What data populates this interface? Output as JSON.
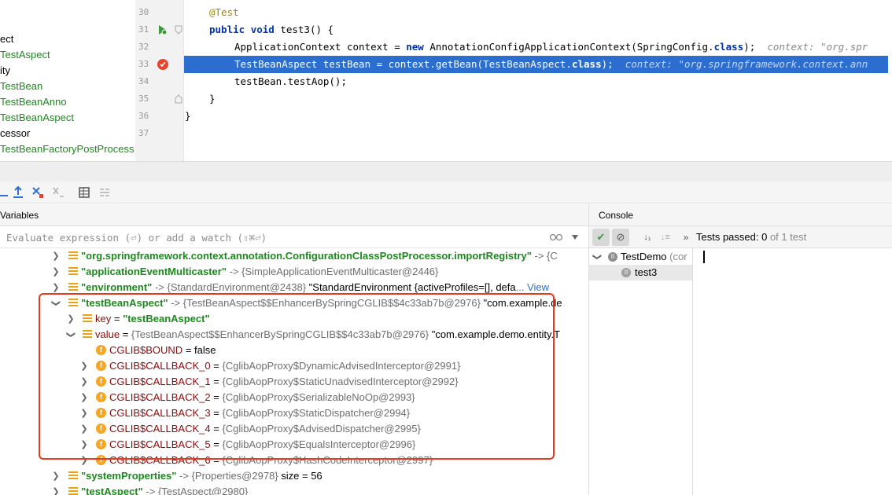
{
  "project_tree": [
    {
      "label": "ect",
      "color": "plain"
    },
    {
      "label": "TestAspect",
      "color": "green"
    },
    {
      "label": "ity",
      "color": "plain"
    },
    {
      "label": "TestBean",
      "color": "green"
    },
    {
      "label": "TestBeanAnno",
      "color": "green"
    },
    {
      "label": "TestBeanAspect",
      "color": "green"
    },
    {
      "label": "cessor",
      "color": "plain"
    },
    {
      "label": "TestBeanFactoryPostProcess",
      "color": "green"
    }
  ],
  "editor": {
    "line_numbers": [
      "30",
      "31",
      "32",
      "33",
      "34",
      "35",
      "36",
      "37"
    ],
    "lines": {
      "l30": {
        "annotation": "@Test"
      },
      "l31": {
        "kw1": "public",
        "kw2": "void",
        "rest": " test3() {"
      },
      "l32": {
        "pre": "ApplicationContext context = ",
        "kw": "new",
        "mid": " AnnotationConfigApplicationContext(SpringConfig.",
        "kw2": "class",
        "post": ");",
        "inlay": "context: \"org.spr"
      },
      "l33": {
        "pre": "TestBeanAspect testBean = context.getBean(TestBeanAspect.",
        "kw": "class",
        "post": ");",
        "inlay": "context: \"org.springframework.context.ann"
      },
      "l34": {
        "text": "testBean.testAop();"
      },
      "l35": {
        "text": "}"
      },
      "l36": {
        "text": "}"
      }
    }
  },
  "variables": {
    "title": "Variables",
    "eval_placeholder": "Evaluate expression (⏎) or add a watch (⇧⌘⏎)",
    "rows": {
      "r0": {
        "name": "\"org.springframework.context.annotation.ConfigurationClassPostProcessor.importRegistry\"",
        "arrow": " -> ",
        "value": "{C"
      },
      "r1": {
        "name": "\"applicationEventMulticaster\"",
        "arrow": " -> ",
        "value": "{SimpleApplicationEventMulticaster@2446}"
      },
      "r2": {
        "name": "\"environment\"",
        "arrow": " -> ",
        "value": "{StandardEnvironment@2438}",
        "extra": " \"StandardEnvironment {activeProfiles=[], defa",
        "link": "... View"
      },
      "r3": {
        "name": "\"testBeanAspect\"",
        "arrow": " -> ",
        "value": "{TestBeanAspect$$EnhancerBySpringCGLIB$$4c33ab7b@2976}",
        "extra": " \"com.example.de"
      },
      "r4": {
        "name": "key",
        "eq": " = ",
        "value": "\"testBeanAspect\""
      },
      "r5": {
        "name": "value",
        "eq": " = ",
        "value": "{TestBeanAspect$$EnhancerBySpringCGLIB$$4c33ab7b@2976}",
        "extra": " \"com.example.demo.entity.T"
      },
      "r6": {
        "name": "CGLIB$BOUND",
        "eq": " = ",
        "value": "false"
      },
      "r7": {
        "name": "CGLIB$CALLBACK_0",
        "eq": " = ",
        "value": "{CglibAopProxy$DynamicAdvisedInterceptor@2991}"
      },
      "r8": {
        "name": "CGLIB$CALLBACK_1",
        "eq": " = ",
        "value": "{CglibAopProxy$StaticUnadvisedInterceptor@2992}"
      },
      "r9": {
        "name": "CGLIB$CALLBACK_2",
        "eq": " = ",
        "value": "{CglibAopProxy$SerializableNoOp@2993}"
      },
      "r10": {
        "name": "CGLIB$CALLBACK_3",
        "eq": " = ",
        "value": "{CglibAopProxy$StaticDispatcher@2994}"
      },
      "r11": {
        "name": "CGLIB$CALLBACK_4",
        "eq": " = ",
        "value": "{CglibAopProxy$AdvisedDispatcher@2995}"
      },
      "r12": {
        "name": "CGLIB$CALLBACK_5",
        "eq": " = ",
        "value": "{CglibAopProxy$EqualsInterceptor@2996}"
      },
      "r13": {
        "name": "CGLIB$CALLBACK_6",
        "eq": " = ",
        "value": "{CglibAopProxy$HashCodeInterceptor@2997}"
      },
      "r14": {
        "name": "\"systemProperties\"",
        "arrow": " -> ",
        "value": "{Properties@2978}",
        "extra": "  size = 56"
      },
      "r15": {
        "name": "\"testAspect\"",
        "arrow": " -> ",
        "value": "{TestAspect@2980}"
      }
    }
  },
  "console": {
    "title": "Console",
    "tests_label": "Tests passed: ",
    "tests_count": "0",
    "tests_suffix": " of 1 test",
    "tree_root": "TestDemo",
    "tree_root_suffix": " (cor",
    "tree_child": "test3"
  },
  "colors": {
    "highlight_line": "#2c6ed0",
    "red_box": "#e8391f",
    "string_green": "#1a8a1a",
    "field_red": "#8b0a0a"
  }
}
